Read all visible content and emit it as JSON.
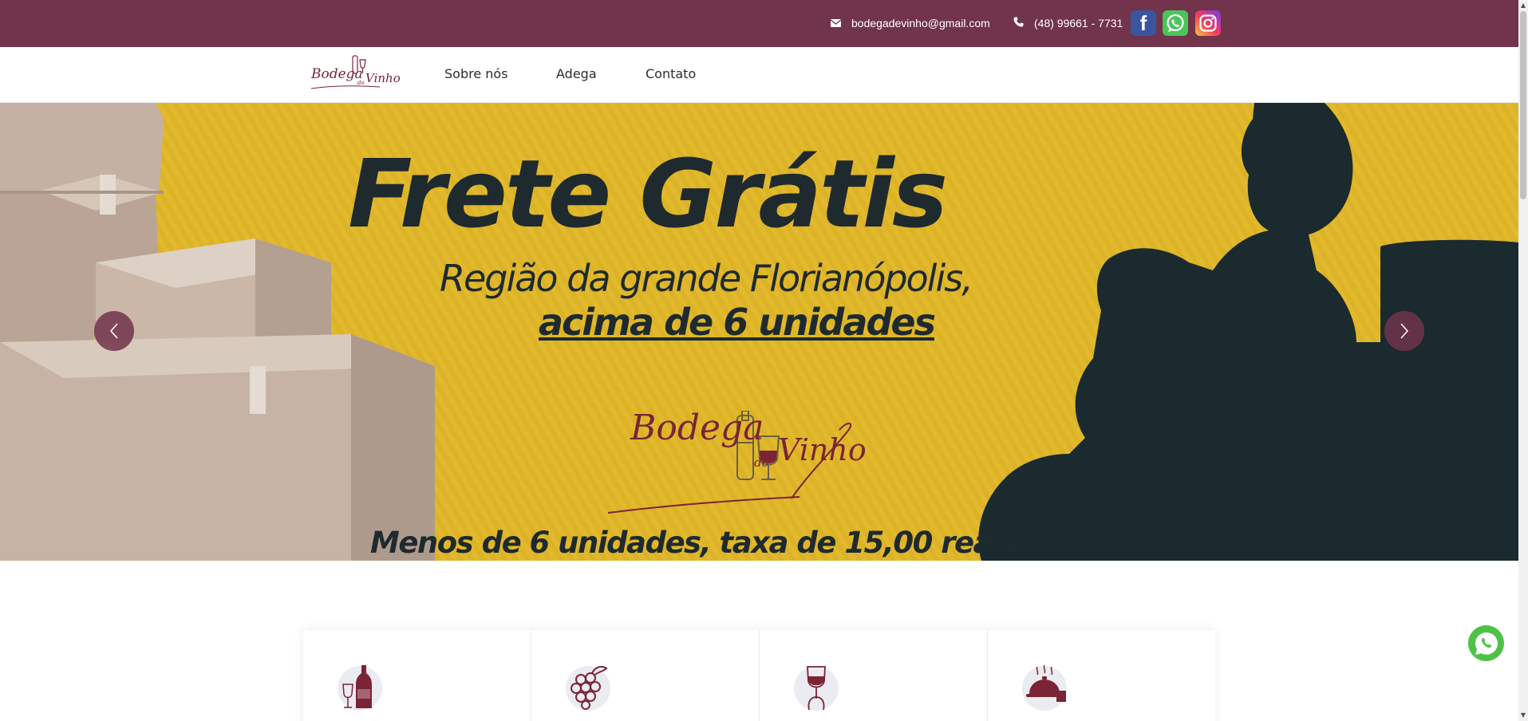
{
  "topbar": {
    "email": "bodegadevinho@gmail.com",
    "phone": "(48) 99661 - 7731",
    "icons": [
      "envelope-icon",
      "phone-icon",
      "facebook-icon",
      "whatsapp-icon",
      "instagram-icon"
    ],
    "facebook_glyph": "f",
    "background": "#71344b"
  },
  "logo": {
    "name": "Bodega",
    "do": "do",
    "vinho": "Vinho"
  },
  "nav": {
    "items": [
      {
        "label": "Sobre nós"
      },
      {
        "label": "Adega"
      },
      {
        "label": "Contato"
      }
    ]
  },
  "hero": {
    "title": "Frete Grátis",
    "subtitle_line1": "Região da grande Florianópolis,",
    "subtitle_line2": "acima de 6 unidades",
    "brand_name": "Bodega",
    "brand_do": "do",
    "brand_vinho": "Vinho",
    "bottom_text": "Menos de 6 unidades, taxa de 15,00 reais",
    "prev_icon": "chevron-left-icon",
    "next_icon": "chevron-right-icon",
    "background": "#e2b92c",
    "text_color": "#1e2a2e"
  },
  "features": {
    "icons": [
      "wine-bottle-glass-icon",
      "grapes-icon",
      "wine-tasting-icon",
      "food-cloche-icon"
    ]
  },
  "floating": {
    "icon": "whatsapp-float-icon",
    "color": "#4dc247"
  }
}
